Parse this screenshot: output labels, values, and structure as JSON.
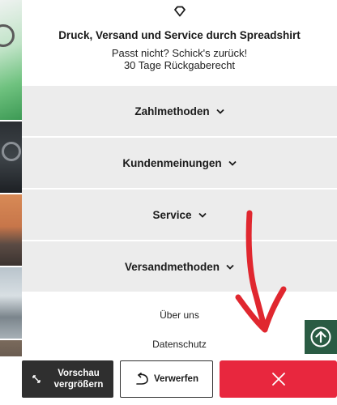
{
  "service": {
    "title": "Druck, Versand und Service durch Spreadshirt",
    "line1": "Passt nicht? Schick's zurück!",
    "line2": "30 Tage Rückgaberecht",
    "icon": "diamond-icon"
  },
  "accordion": [
    {
      "label": "Zahlmethoden",
      "icon": "chevron-down-icon"
    },
    {
      "label": "Kundenmeinungen",
      "icon": "chevron-down-icon"
    },
    {
      "label": "Service",
      "icon": "chevron-down-icon"
    },
    {
      "label": "Versandmethoden",
      "icon": "chevron-down-icon"
    }
  ],
  "footer": {
    "links": [
      "Über uns",
      "Datenschutz"
    ]
  },
  "actions": {
    "preview_label_1": "Vorschau",
    "preview_label_2": "vergrößern",
    "discard_label": "Verwerfen"
  },
  "colors": {
    "accordion_bg": "#ececec",
    "preview_bg": "#2f2f2f",
    "close_bg": "#e8273e",
    "scrolltop_bg": "#2a5b43",
    "annotation": "#e0272f"
  }
}
